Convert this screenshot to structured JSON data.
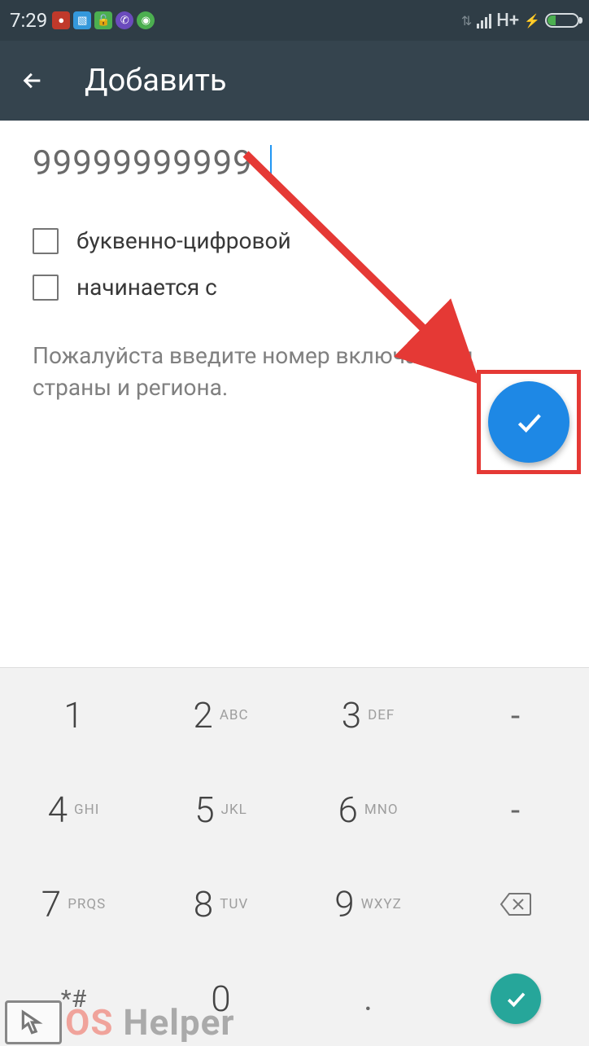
{
  "status": {
    "time": "7:29",
    "network": "H+"
  },
  "header": {
    "title": "Добавить"
  },
  "input": {
    "value": "99999999999"
  },
  "checkboxes": [
    {
      "label": "буквенно-цифровой"
    },
    {
      "label": "начинается с"
    }
  ],
  "hint": "Пожалуйста введите номер включая код страны и региона.",
  "keypad": {
    "k1": "1",
    "k2": "2",
    "k2l": "ABC",
    "k3": "3",
    "k3l": "DEF",
    "k4": "4",
    "k4l": "GHI",
    "k5": "5",
    "k5l": "JKL",
    "k6": "6",
    "k6l": "MNO",
    "k7": "7",
    "k7l": "PRQS",
    "k8": "8",
    "k8l": "TUV",
    "k9": "9",
    "k9l": "WXYZ",
    "k0": "0",
    "star": "*#",
    "dot": ".",
    "dash": "-",
    "dash2": "-"
  },
  "watermark": {
    "text_part1": "OS ",
    "text_part2": "Helper"
  }
}
